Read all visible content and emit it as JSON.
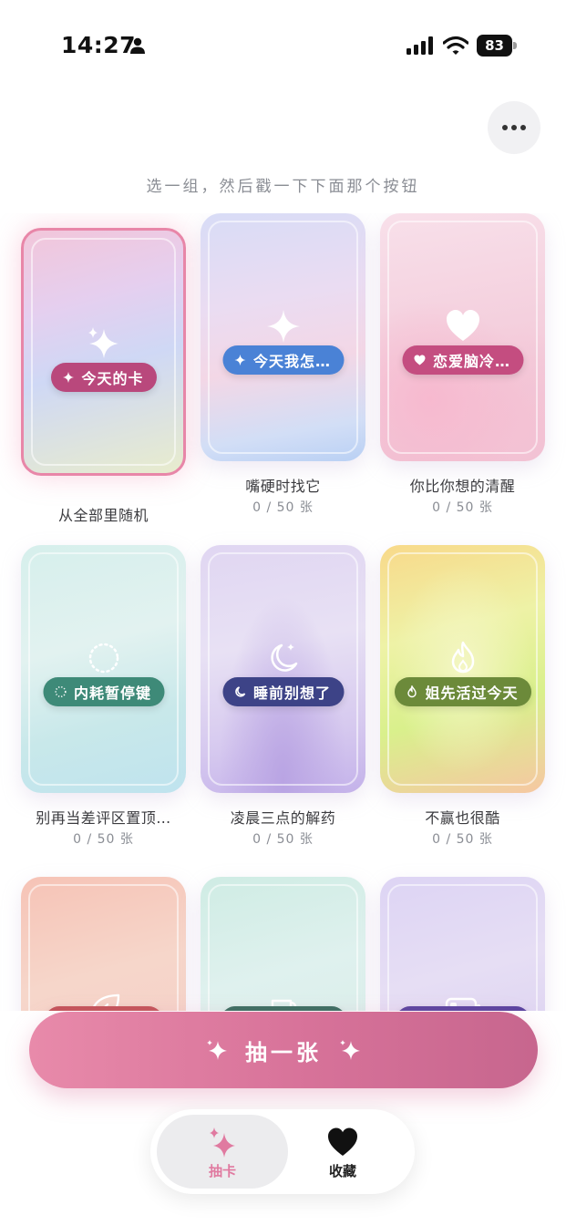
{
  "status": {
    "time": "14:27",
    "battery": "83"
  },
  "hint": "选一组，然后戳一下下面那个按钮",
  "decks": [
    {
      "badge": "今天的卡",
      "title": "从全部里随机",
      "count": "",
      "badge_color": "#b9487c",
      "icon": "sparkle-icon"
    },
    {
      "badge": "今天我怎…",
      "title": "嘴硬时找它",
      "count": "0 / 50 张",
      "badge_color": "#4a82d6",
      "icon": "sparkle-icon"
    },
    {
      "badge": "恋爱脑冷…",
      "title": "你比你想的清醒",
      "count": "0 / 50 张",
      "badge_color": "#c44d80",
      "icon": "heart-icon"
    },
    {
      "badge": "内耗暂停键",
      "title": "别再当差评区置顶…",
      "count": "0 / 50 张",
      "badge_color": "#3e8a78",
      "icon": "dotted-circle-icon"
    },
    {
      "badge": "睡前别想了",
      "title": "凌晨三点的解药",
      "count": "0 / 50 张",
      "badge_color": "#3d4387",
      "icon": "moon-icon"
    },
    {
      "badge": "姐先活过今天",
      "title": "不赢也很酷",
      "count": "0 / 50 张",
      "badge_color": "#6c8a3a",
      "icon": "flame-icon"
    },
    {
      "badge": "",
      "title": "",
      "count": "",
      "badge_color": "#c4545a",
      "icon": "leaf-icon"
    },
    {
      "badge": "",
      "title": "",
      "count": "",
      "badge_color": "#3b6e62",
      "icon": "cup-icon"
    },
    {
      "badge": "",
      "title": "",
      "count": "",
      "badge_color": "#5a44a0",
      "icon": "battery-low-icon"
    }
  ],
  "draw_button": "抽一张",
  "tabs": {
    "draw": "抽卡",
    "favorites": "收藏"
  },
  "colors": {
    "accent": "#e07aa0",
    "button": "#d77299"
  }
}
